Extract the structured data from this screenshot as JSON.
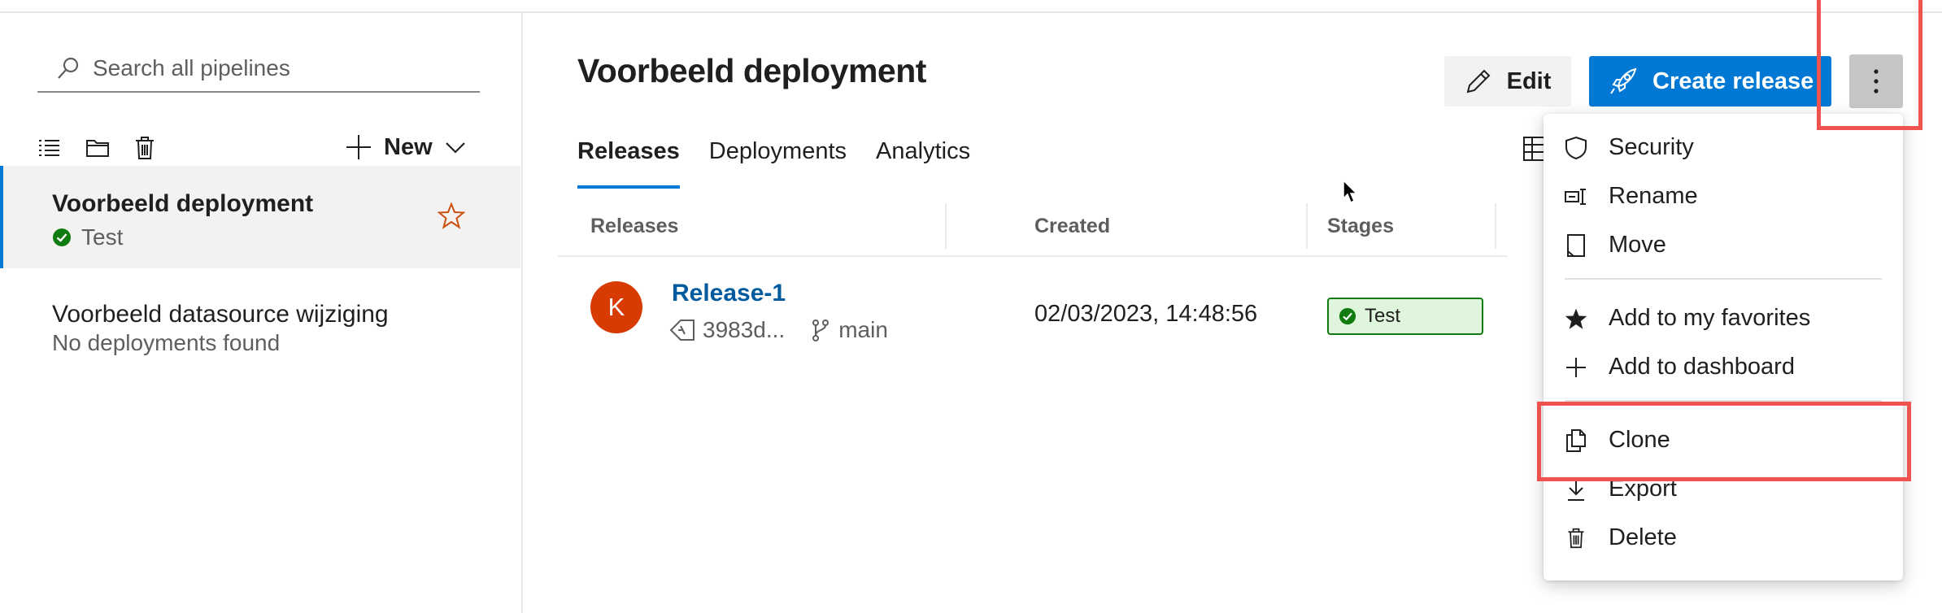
{
  "sidebar": {
    "search_placeholder": "Search all pipelines",
    "new_label": "New",
    "pipelines": [
      {
        "name": "Voorbeeld deployment",
        "status": "Test",
        "favorite_icon": "star-outline-icon",
        "status_color": "#107c10"
      },
      {
        "name": "Voorbeeld datasource wijziging",
        "status": "No deployments found"
      }
    ]
  },
  "header": {
    "title": "Voorbeeld deployment",
    "edit_label": "Edit",
    "create_release_label": "Create release",
    "accent_color": "#0078d4"
  },
  "tabs": [
    "Releases",
    "Deployments",
    "Analytics"
  ],
  "table": {
    "columns": [
      "Releases",
      "Created",
      "Stages"
    ],
    "rows": [
      {
        "avatar_initial": "K",
        "release": "Release-1",
        "commit": "3983d...",
        "branch": "main",
        "created": "02/03/2023, 14:48:56",
        "stage": "Test"
      }
    ]
  },
  "menu": {
    "items": [
      {
        "label": "Security",
        "icon": "shield-icon"
      },
      {
        "label": "Rename",
        "icon": "rename-icon"
      },
      {
        "label": "Move",
        "icon": "move-icon"
      },
      {
        "label": "Add to my favorites",
        "icon": "star-filled-icon"
      },
      {
        "label": "Add to dashboard",
        "icon": "plus-icon"
      },
      {
        "label": "Clone",
        "icon": "clone-icon"
      },
      {
        "label": "Export",
        "icon": "download-icon"
      },
      {
        "label": "Delete",
        "icon": "trash-icon"
      }
    ]
  },
  "highlight_color": "#ef5350"
}
